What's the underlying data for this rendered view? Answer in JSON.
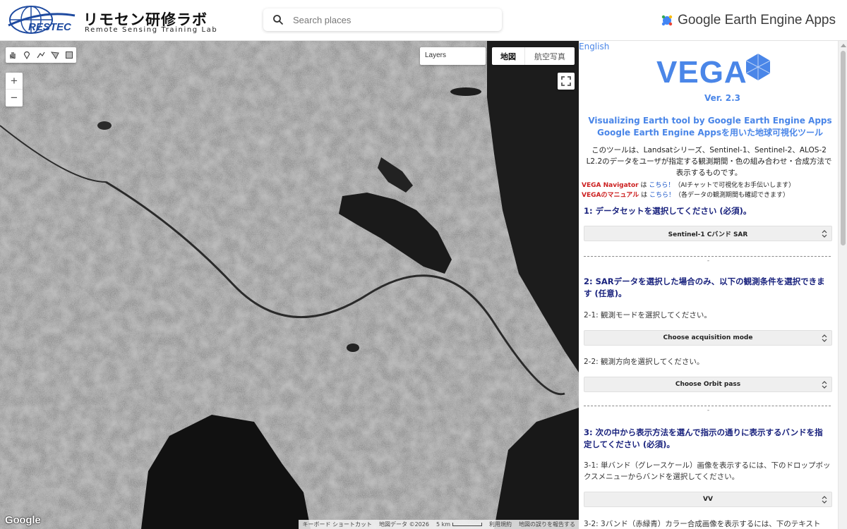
{
  "header": {
    "logo_jp": "リモセン研修ラボ",
    "logo_en": "Remote Sensing Training Lab",
    "logo_restec": "RESTEC",
    "search_placeholder": "Search places",
    "gee_label": "Google Earth Engine Apps"
  },
  "map": {
    "layers_label": "Layers",
    "map_type": {
      "map": "地図",
      "satellite": "航空写真"
    },
    "zoom_in": "+",
    "zoom_out": "−",
    "google_logo": "Google",
    "attribution": {
      "shortcuts": "キーボード ショートカット",
      "map_data": "地図データ ©2026",
      "scale": "5 km",
      "terms": "利用規約",
      "report": "地図の誤りを報告する"
    },
    "draw_tools": [
      "hand-icon",
      "marker-icon",
      "line-icon",
      "polygon-icon",
      "rectangle-icon"
    ]
  },
  "panel": {
    "english_link": "English",
    "title": "VEGA",
    "version": "Ver. 2.3",
    "subtitle_en": "Visualizing Earth tool by Google Earth Engine Apps",
    "subtitle_jp": "Google Earth Engine Appsを用いた地球可視化ツール",
    "description": "このツールは、Landsatシリーズ、Sentinel-1、Sentinel-2、ALOS-2 L2.2のデータをユーザが指定する観測期間・色の組み合わせ・合成方法で表示するものです。",
    "navigator": {
      "name": "VEGA Navigator",
      "is": " は ",
      "link": "こちら！",
      "note": "（AIチャットで可視化をお手伝いします）"
    },
    "manual": {
      "name": "VEGAのマニュアル",
      "is": " は ",
      "link": "こちら！",
      "note": "（各データの観測期間も確認できます）"
    },
    "step1": {
      "title": "1: データセットを選択してください (必須)。",
      "select": "Sentinel-1 Cバンド SAR"
    },
    "step2": {
      "title": "2: SARデータを選択した場合のみ、以下の観測条件を選択できます (任意)。",
      "mode_label": "2-1: 観測モードを選択してください。",
      "mode_select": "Choose acquisition mode",
      "dir_label": "2-2: 観測方向を選択してください。",
      "dir_select": "Choose Orbit pass"
    },
    "step3": {
      "title": "3: 次の中から表示方法を選んで指示の通りに表示するバンドを指定してください (必須)。",
      "single_label": "3-1: 単バンド（グレースケール）画像を表示するには、下のドロップボックスメニューからバンドを選択してください。",
      "single_select": "VV",
      "rgb_label": "3-2: 3バンド（赤緑青）カラー合成画像を表示するには、下のテキスト"
    },
    "separator": "-"
  },
  "colors": {
    "accent": "#4a86e8",
    "section": "#1a237e",
    "warning": "#cc1f1f",
    "link": "#1a56c8"
  }
}
